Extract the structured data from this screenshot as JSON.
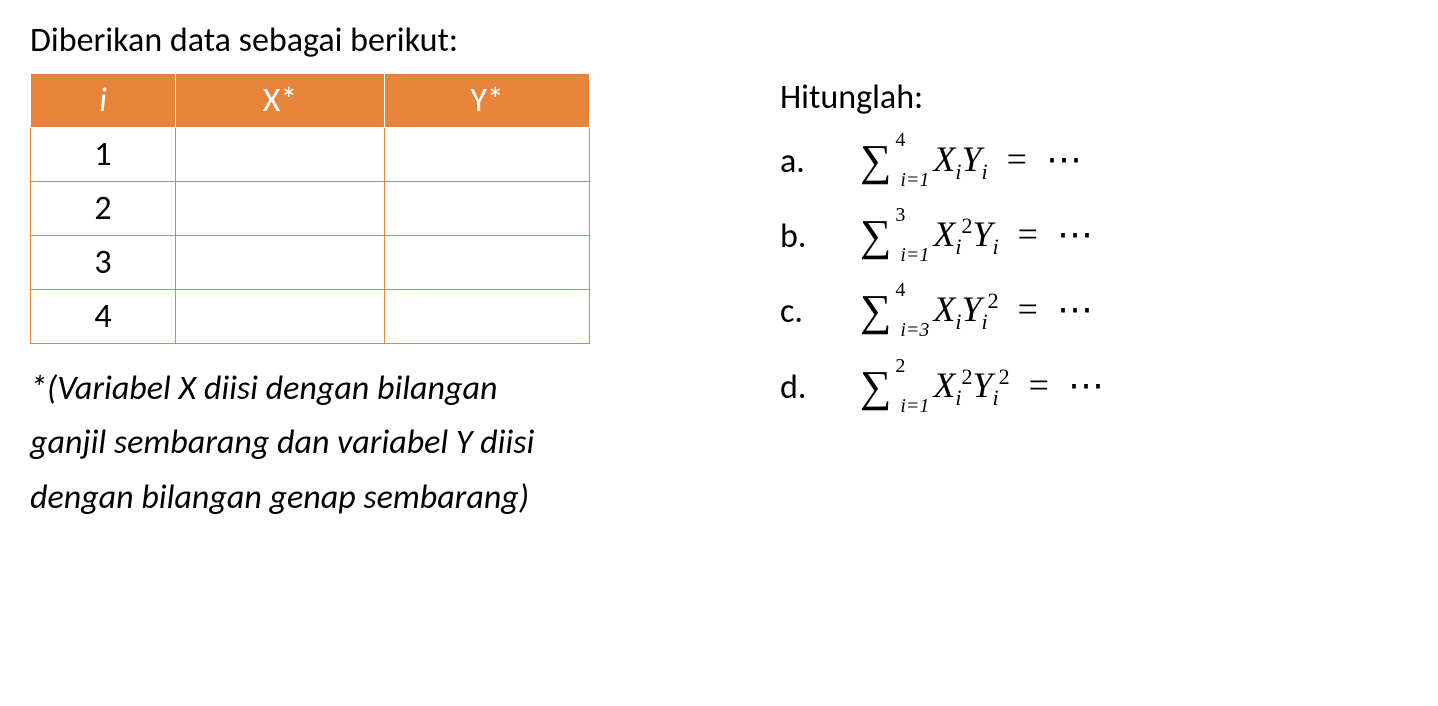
{
  "intro": "Diberikan data sebagai berikut:",
  "table": {
    "headers": {
      "col1": "i",
      "col2": "X*",
      "col3": "Y*"
    },
    "rows": [
      {
        "i": "1",
        "x": "",
        "y": ""
      },
      {
        "i": "2",
        "x": "",
        "y": ""
      },
      {
        "i": "3",
        "x": "",
        "y": ""
      },
      {
        "i": "4",
        "x": "",
        "y": ""
      }
    ]
  },
  "footnote": {
    "line1": "*(Variabel X diisi dengan bilangan",
    "line2": "ganjil sembarang dan variabel Y diisi",
    "line3": "dengan bilangan genap sembarang)"
  },
  "hitung_title": "Hitunglah:",
  "questions": {
    "a": {
      "label": "a.",
      "upper": "4",
      "lower": "i=1",
      "term": "XᵢYᵢ",
      "x_sup": "",
      "y_sup": ""
    },
    "b": {
      "label": "b.",
      "upper": "3",
      "lower": "i=1",
      "x_sup": "2",
      "y_sup": ""
    },
    "c": {
      "label": "c.",
      "upper": "4",
      "lower": "i=3",
      "x_sup": "",
      "y_sup": "2"
    },
    "d": {
      "label": "d.",
      "upper": "2",
      "lower": "i=1",
      "x_sup": "2",
      "y_sup": "2"
    }
  },
  "symbols": {
    "sigma": "∑",
    "equals": "=",
    "dots": "⋯",
    "X": "X",
    "Y": "Y",
    "i_sub": "i"
  }
}
